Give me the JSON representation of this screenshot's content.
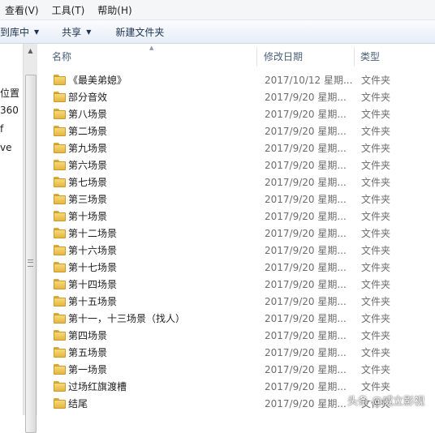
{
  "menu": {
    "view": "查看(V)",
    "tools": "工具(T)",
    "help": "帮助(H)"
  },
  "toolbar": {
    "library": "到库中",
    "share": "共享",
    "new_folder": "新建文件夹"
  },
  "nav": {
    "items": [
      "位置",
      "360",
      "f",
      "ve"
    ]
  },
  "columns": {
    "name": "名称",
    "date": "修改日期",
    "type": "类型"
  },
  "files": [
    {
      "name": "《最美弟媳》",
      "date": "2017/10/12 星期...",
      "type": "文件夹"
    },
    {
      "name": "部分音效",
      "date": "2017/9/20 星期...",
      "type": "文件夹"
    },
    {
      "name": "第八场景",
      "date": "2017/9/20 星期...",
      "type": "文件夹"
    },
    {
      "name": "第二场景",
      "date": "2017/9/20 星期...",
      "type": "文件夹"
    },
    {
      "name": "第九场景",
      "date": "2017/9/20 星期...",
      "type": "文件夹"
    },
    {
      "name": "第六场景",
      "date": "2017/9/20 星期...",
      "type": "文件夹"
    },
    {
      "name": "第七场景",
      "date": "2017/9/20 星期...",
      "type": "文件夹"
    },
    {
      "name": "第三场景",
      "date": "2017/9/20 星期...",
      "type": "文件夹"
    },
    {
      "name": "第十场景",
      "date": "2017/9/20 星期...",
      "type": "文件夹"
    },
    {
      "name": "第十二场景",
      "date": "2017/9/20 星期...",
      "type": "文件夹"
    },
    {
      "name": "第十六场景",
      "date": "2017/9/20 星期...",
      "type": "文件夹"
    },
    {
      "name": "第十七场景",
      "date": "2017/9/20 星期...",
      "type": "文件夹"
    },
    {
      "name": "第十四场景",
      "date": "2017/9/20 星期...",
      "type": "文件夹"
    },
    {
      "name": "第十五场景",
      "date": "2017/9/20 星期...",
      "type": "文件夹"
    },
    {
      "name": "第十一，十三场景（找人）",
      "date": "2017/9/20 星期...",
      "type": "文件夹"
    },
    {
      "name": "第四场景",
      "date": "2017/9/20 星期...",
      "type": "文件夹"
    },
    {
      "name": "第五场景",
      "date": "2017/9/20 星期...",
      "type": "文件夹"
    },
    {
      "name": "第一场景",
      "date": "2017/9/20 星期...",
      "type": "文件夹"
    },
    {
      "name": "过场红旗渡槽",
      "date": "2017/9/20 星期...",
      "type": "文件夹"
    },
    {
      "name": "结尾",
      "date": "2017/9/20 星期...",
      "type": "文件夹"
    }
  ],
  "watermark": "头条 @威立影视",
  "colors": {
    "toolbar_text": "#1e3250",
    "header_text": "#4c607a",
    "folder": "#e6b640"
  }
}
